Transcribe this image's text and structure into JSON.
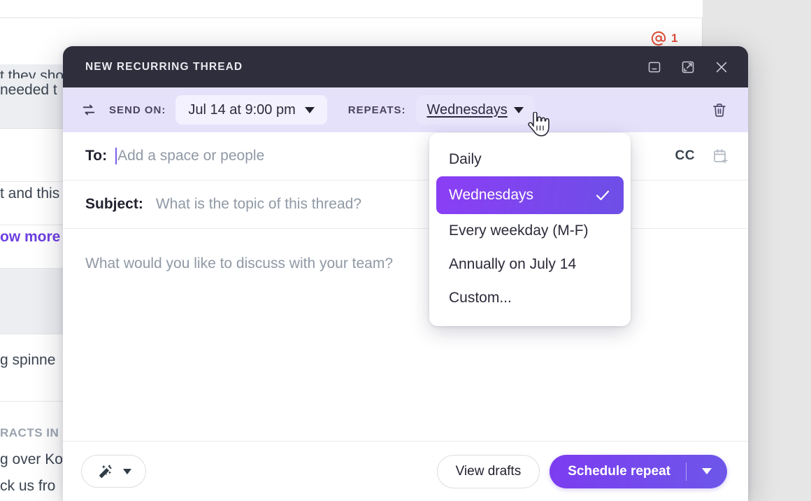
{
  "background": {
    "mention": {
      "icon": "at-mention-icon",
      "count": "1"
    },
    "rows": [
      {
        "text": "t they sho",
        "shaded": true
      },
      {
        "text": "needed t",
        "shaded": true
      },
      {
        "text": "t and this",
        "shaded": false
      },
      {
        "text": "ow more",
        "shaded": false,
        "link": true
      },
      {
        "text": "g spinne",
        "shaded": false
      },
      {
        "text": "RACTS IN",
        "shaded": false,
        "caps": true
      },
      {
        "text": "g over Ko",
        "shaded": false
      },
      {
        "text": "ck us fro",
        "shaded": false
      }
    ]
  },
  "modal": {
    "title": "NEW RECURRING THREAD",
    "window_buttons": [
      {
        "name": "minimize-button",
        "icon": "minimize-icon"
      },
      {
        "name": "expand-button",
        "icon": "expand-icon"
      },
      {
        "name": "close-button",
        "icon": "close-icon"
      }
    ],
    "schedule_bar": {
      "sync_icon": "repeat-sync-icon",
      "send_on_label": "SEND ON:",
      "send_on_value": "Jul 14 at 9:00 pm",
      "repeats_label": "REPEATS:",
      "repeats_value": "Wednesdays",
      "delete_icon": "trash-icon"
    },
    "recipients": {
      "to_label": "To:",
      "to_placeholder": "Add a space or people",
      "cc_label": "CC",
      "calendar_icon": "calendar-add-icon"
    },
    "subject": {
      "label": "Subject:",
      "placeholder": "What is the topic of this thread?"
    },
    "body": {
      "placeholder": "What would you like to discuss with your team?"
    },
    "footer": {
      "wand_icon": "magic-wand-icon",
      "view_drafts_label": "View drafts",
      "primary_label": "Schedule repeat"
    }
  },
  "dropdown": {
    "items": [
      {
        "label": "Daily",
        "selected": false
      },
      {
        "label": "Wednesdays",
        "selected": true
      },
      {
        "label": "Every weekday (M-F)",
        "selected": false
      },
      {
        "label": "Annually on July 14",
        "selected": false
      },
      {
        "label": "Custom...",
        "selected": false
      }
    ]
  },
  "colors": {
    "accent": "#7c3cf0",
    "header_bg": "#2e2e3c",
    "schedule_bar_bg": "#e6e1fb",
    "mention": "#e0513a"
  }
}
